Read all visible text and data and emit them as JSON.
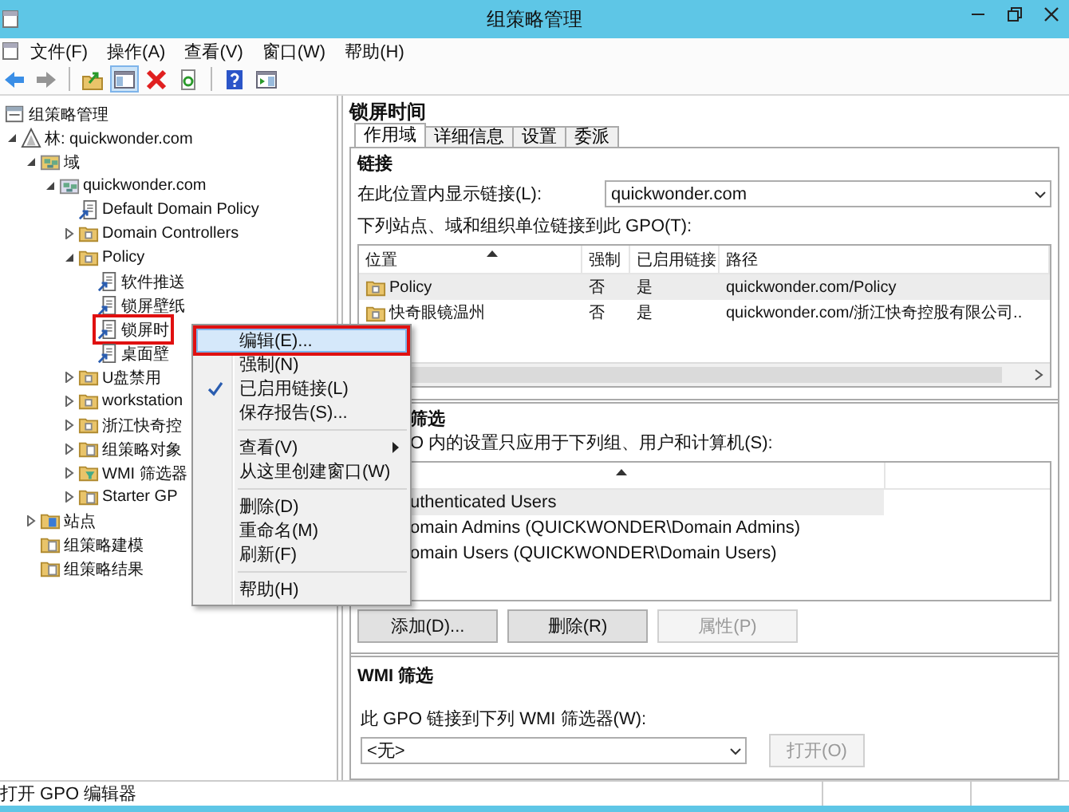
{
  "window": {
    "title": "组策略管理"
  },
  "menu": [
    "文件(F)",
    "操作(A)",
    "查看(V)",
    "窗口(W)",
    "帮助(H)"
  ],
  "toolbar": [
    {
      "kind": "back",
      "disabled": false,
      "pressed": false
    },
    {
      "kind": "forward",
      "disabled": true,
      "pressed": false
    },
    {
      "kind": "separator"
    },
    {
      "kind": "up",
      "disabled": false,
      "pressed": false
    },
    {
      "kind": "tree",
      "disabled": false,
      "pressed": true
    },
    {
      "kind": "delete",
      "disabled": false,
      "pressed": false
    },
    {
      "kind": "refresh",
      "disabled": false,
      "pressed": false
    },
    {
      "kind": "separator"
    },
    {
      "kind": "help",
      "disabled": false,
      "pressed": false
    },
    {
      "kind": "pane",
      "disabled": false,
      "pressed": false
    }
  ],
  "tree": {
    "label": "组策略管理",
    "kind": "console",
    "selected": false,
    "annotated": false,
    "children": [
      {
        "label": "林: quickwonder.com",
        "kind": "forest",
        "expanded": true,
        "selected": false,
        "annotated": false,
        "children": [
          {
            "label": "域",
            "kind": "domains",
            "expanded": true,
            "selected": false,
            "annotated": false,
            "children": [
              {
                "label": "quickwonder.com",
                "kind": "domain",
                "expanded": true,
                "selected": false,
                "annotated": false,
                "children": [
                  {
                    "label": "Default Domain Policy",
                    "kind": "link",
                    "selected": false,
                    "annotated": false
                  },
                  {
                    "label": "Domain Controllers",
                    "kind": "ou",
                    "expanded": false,
                    "selected": false,
                    "annotated": false
                  },
                  {
                    "label": "Policy",
                    "kind": "ou",
                    "expanded": true,
                    "selected": false,
                    "annotated": false,
                    "children": [
                      {
                        "label": "软件推送",
                        "kind": "link",
                        "selected": false,
                        "annotated": false
                      },
                      {
                        "label": "锁屏壁纸",
                        "kind": "link",
                        "selected": false,
                        "annotated": false
                      },
                      {
                        "label": "锁屏时",
                        "kind": "link",
                        "selected": false,
                        "annotated": true
                      },
                      {
                        "label": "桌面壁",
                        "kind": "link",
                        "selected": false,
                        "annotated": false
                      }
                    ]
                  },
                  {
                    "label": "U盘禁用",
                    "kind": "ou",
                    "expanded": false,
                    "selected": false,
                    "annotated": false
                  },
                  {
                    "label": "workstation",
                    "kind": "ou",
                    "expanded": false,
                    "selected": false,
                    "annotated": false
                  },
                  {
                    "label": "浙江快奇控",
                    "kind": "ou",
                    "expanded": false,
                    "selected": false,
                    "annotated": false
                  },
                  {
                    "label": "组策略对象",
                    "kind": "container",
                    "expanded": false,
                    "selected": false,
                    "annotated": false
                  },
                  {
                    "label": "WMI 筛选器",
                    "kind": "filter",
                    "expanded": false,
                    "selected": false,
                    "annotated": false
                  },
                  {
                    "label": "Starter GP",
                    "kind": "container",
                    "expanded": false,
                    "selected": false,
                    "annotated": false
                  }
                ]
              }
            ]
          },
          {
            "label": "站点",
            "kind": "sites",
            "expanded": false,
            "selected": false,
            "annotated": false
          },
          {
            "label": "组策略建模",
            "kind": "modeling",
            "selected": false,
            "annotated": false
          },
          {
            "label": "组策略结果",
            "kind": "results",
            "selected": false,
            "annotated": false
          }
        ]
      }
    ]
  },
  "details": {
    "title": "锁屏时间",
    "tabs": [
      {
        "label": "作用域",
        "selected": true
      },
      {
        "label": "详细信息",
        "selected": false
      },
      {
        "label": "设置",
        "selected": false
      },
      {
        "label": "委派",
        "selected": false
      }
    ],
    "links": {
      "heading": "链接",
      "location_label": "在此位置内显示链接(L):",
      "location_value": "quickwonder.com",
      "list_label": "下列站点、域和组织单位链接到此 GPO(T):",
      "columns": [
        "位置",
        "强制",
        "已启用链接",
        "路径"
      ],
      "rows": [
        {
          "location": "Policy",
          "enforced": "否",
          "enabled": "是",
          "path": "quickwonder.com/Policy",
          "selected": true
        },
        {
          "location": "快奇眼镜温州",
          "enforced": "否",
          "enabled": "是",
          "path": "quickwonder.com/浙江快奇控股有限公司..",
          "selected": false
        }
      ]
    },
    "security": {
      "heading": "筛选",
      "label": "O 内的设置只应用于下列组、用户和计算机(S):",
      "rows": [
        {
          "name": "uthenticated Users",
          "selected": true
        },
        {
          "name": "omain Admins (QUICKWONDER\\Domain Admins)",
          "selected": false
        },
        {
          "name": "omain Users (QUICKWONDER\\Domain Users)",
          "selected": false
        }
      ],
      "buttons": [
        {
          "label": "添加(D)...",
          "disabled": false
        },
        {
          "label": "删除(R)",
          "disabled": false
        },
        {
          "label": "属性(P)",
          "disabled": true
        }
      ]
    },
    "wmi": {
      "heading": "WMI 筛选",
      "label": "此 GPO 链接到下列 WMI 筛选器(W):",
      "value": "<无>",
      "button": {
        "label": "打开(O)",
        "disabled": true
      }
    }
  },
  "context_menu": [
    {
      "kind": "item",
      "label": "编辑(E)...",
      "highlighted": true,
      "annotated": true,
      "checked": false,
      "submenu": false
    },
    {
      "kind": "item",
      "label": "强制(N)",
      "highlighted": false,
      "annotated": false,
      "checked": false,
      "submenu": false
    },
    {
      "kind": "item",
      "label": "已启用链接(L)",
      "highlighted": false,
      "annotated": false,
      "checked": true,
      "submenu": false
    },
    {
      "kind": "item",
      "label": "保存报告(S)...",
      "highlighted": false,
      "annotated": false,
      "checked": false,
      "submenu": false
    },
    {
      "kind": "separator"
    },
    {
      "kind": "item",
      "label": "查看(V)",
      "highlighted": false,
      "annotated": false,
      "checked": false,
      "submenu": true
    },
    {
      "kind": "item",
      "label": "从这里创建窗口(W)",
      "highlighted": false,
      "annotated": false,
      "checked": false,
      "submenu": false
    },
    {
      "kind": "separator"
    },
    {
      "kind": "item",
      "label": "删除(D)",
      "highlighted": false,
      "annotated": false,
      "checked": false,
      "submenu": false
    },
    {
      "kind": "item",
      "label": "重命名(M)",
      "highlighted": false,
      "annotated": false,
      "checked": false,
      "submenu": false
    },
    {
      "kind": "item",
      "label": "刷新(F)",
      "highlighted": false,
      "annotated": false,
      "checked": false,
      "submenu": false
    },
    {
      "kind": "separator"
    },
    {
      "kind": "item",
      "label": "帮助(H)",
      "highlighted": false,
      "annotated": false,
      "checked": false,
      "submenu": false
    }
  ],
  "status_bar": {
    "text": "打开 GPO 编辑器"
  }
}
